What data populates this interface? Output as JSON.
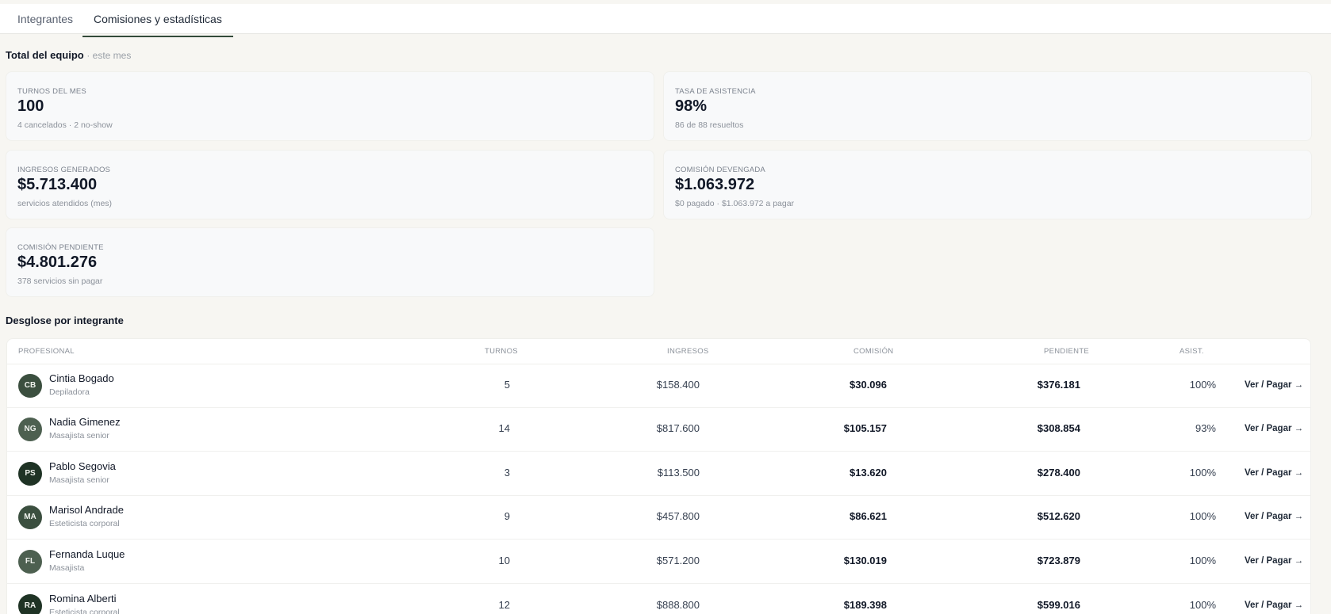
{
  "tabs": [
    {
      "label": "Integrantes",
      "active": false
    },
    {
      "label": "Comisiones y estadísticas",
      "active": true
    }
  ],
  "summary": {
    "title": "Total del equipo",
    "period": "· este mes",
    "cards": [
      {
        "label": "TURNOS DEL MES",
        "value": "100",
        "sub": "4 cancelados · 2 no-show"
      },
      {
        "label": "TASA DE ASISTENCIA",
        "value": "98%",
        "sub": "86 de 88 resueltos"
      },
      {
        "label": "INGRESOS GENERADOS",
        "value": "$5.713.400",
        "sub": "servicios atendidos (mes)"
      },
      {
        "label": "COMISIÓN DEVENGADA",
        "value": "$1.063.972",
        "sub": "$0 pagado · $1.063.972 a pagar"
      },
      {
        "label": "COMISIÓN PENDIENTE",
        "value": "$4.801.276",
        "sub": "378 servicios sin pagar"
      }
    ]
  },
  "breakdown": {
    "title": "Desglose por integrante",
    "columns": {
      "professional": "PROFESIONAL",
      "turns": "TURNOS",
      "income": "INGRESOS",
      "commission": "COMISIÓN",
      "pending": "PENDIENTE",
      "attendance": "ASIST."
    },
    "action_label": "Ver / Pagar →",
    "rows": [
      {
        "initials": "CB",
        "name": "Cintia Bogado",
        "role": "Depiladora",
        "turns": "5",
        "income": "$158.400",
        "commission": "$30.096",
        "pending": "$376.181",
        "attendance": "100%"
      },
      {
        "initials": "NG",
        "name": "Nadia Gimenez",
        "role": "Masajista senior",
        "turns": "14",
        "income": "$817.600",
        "commission": "$105.157",
        "pending": "$308.854",
        "attendance": "93%"
      },
      {
        "initials": "PS",
        "name": "Pablo Segovia",
        "role": "Masajista senior",
        "turns": "3",
        "income": "$113.500",
        "commission": "$13.620",
        "pending": "$278.400",
        "attendance": "100%"
      },
      {
        "initials": "MA",
        "name": "Marisol Andrade",
        "role": "Esteticista corporal",
        "turns": "9",
        "income": "$457.800",
        "commission": "$86.621",
        "pending": "$512.620",
        "attendance": "100%"
      },
      {
        "initials": "FL",
        "name": "Fernanda Luque",
        "role": "Masajista",
        "turns": "10",
        "income": "$571.200",
        "commission": "$130.019",
        "pending": "$723.879",
        "attendance": "100%"
      },
      {
        "initials": "RA",
        "name": "Romina Alberti",
        "role": "Esteticista corporal",
        "turns": "12",
        "income": "$888.800",
        "commission": "$189.398",
        "pending": "$599.016",
        "attendance": "100%"
      }
    ]
  }
}
